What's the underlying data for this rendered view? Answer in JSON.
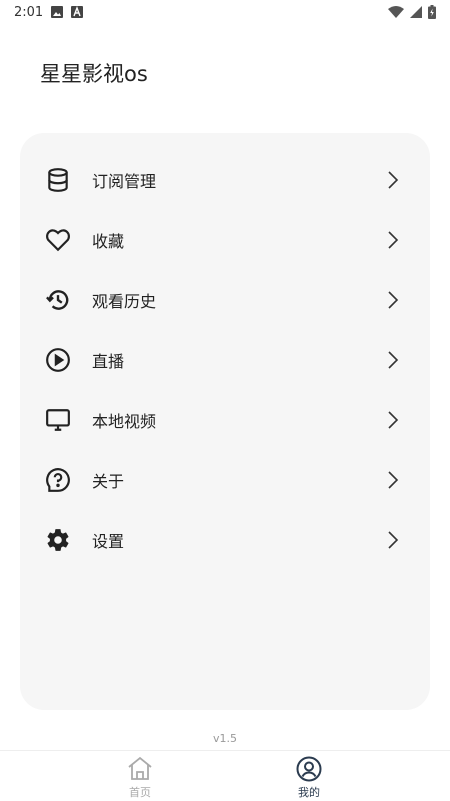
{
  "status_bar": {
    "time": "2:01",
    "icons": [
      "image-icon",
      "a-icon",
      "wifi-icon",
      "signal-icon",
      "battery-charging-icon"
    ]
  },
  "app": {
    "title": "星星影视os"
  },
  "menu": {
    "items": [
      {
        "label": "订阅管理",
        "icon": "database-icon"
      },
      {
        "label": "收藏",
        "icon": "heart-icon"
      },
      {
        "label": "观看历史",
        "icon": "history-icon"
      },
      {
        "label": "直播",
        "icon": "play-circle-icon"
      },
      {
        "label": "本地视频",
        "icon": "monitor-icon"
      },
      {
        "label": "关于",
        "icon": "help-icon"
      },
      {
        "label": "设置",
        "icon": "gear-icon"
      }
    ]
  },
  "version": "v1.5",
  "bottom_nav": {
    "items": [
      {
        "label": "首页",
        "icon": "home-icon",
        "active": false
      },
      {
        "label": "我的",
        "icon": "user-circle-icon",
        "active": true
      }
    ]
  },
  "colors": {
    "card_bg": "#f6f6f6",
    "active_nav": "#2b3b4f",
    "inactive_nav": "#aaaaaa",
    "text": "#222222"
  }
}
